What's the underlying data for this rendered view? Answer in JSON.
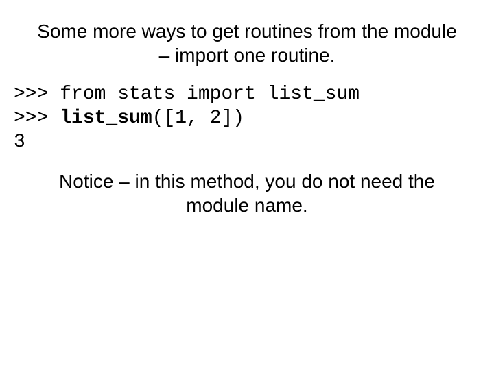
{
  "title_line1": "Some more ways to get routines from the module",
  "title_line2": "– import one routine.",
  "code": {
    "line1_prompt": ">>> ",
    "line1_text": "from stats import list_sum",
    "line2_prompt": ">>> ",
    "line2_bold": "list_sum",
    "line2_rest": "([1, 2])",
    "line3": "3"
  },
  "note_line1": "Notice – in this method, you do not need the",
  "note_line2": "module name."
}
